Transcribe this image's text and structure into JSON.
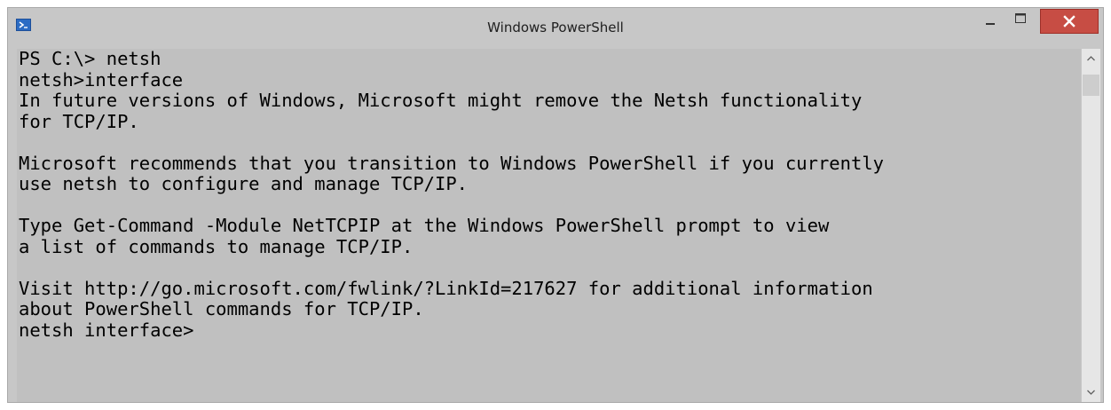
{
  "window": {
    "title": "Windows PowerShell",
    "icon": "powershell-icon",
    "controls": {
      "minimize_icon": "minimize-icon",
      "maximize_icon": "maximize-icon",
      "close_icon": "close-icon",
      "close_color": "#c74d44"
    }
  },
  "console": {
    "background": "#c0c0c0",
    "foreground": "#000000",
    "lines": [
      "PS C:\\> netsh",
      "netsh>interface",
      "In future versions of Windows, Microsoft might remove the Netsh functionality",
      "for TCP/IP.",
      "",
      "Microsoft recommends that you transition to Windows PowerShell if you currently",
      "use netsh to configure and manage TCP/IP.",
      "",
      "Type Get-Command -Module NetTCPIP at the Windows PowerShell prompt to view",
      "a list of commands to manage TCP/IP.",
      "",
      "Visit http://go.microsoft.com/fwlink/?LinkId=217627 for additional information",
      "about PowerShell commands for TCP/IP.",
      "netsh interface>"
    ]
  },
  "scrollbar": {
    "up_icon": "chevron-up-icon",
    "down_icon": "chevron-down-icon"
  }
}
